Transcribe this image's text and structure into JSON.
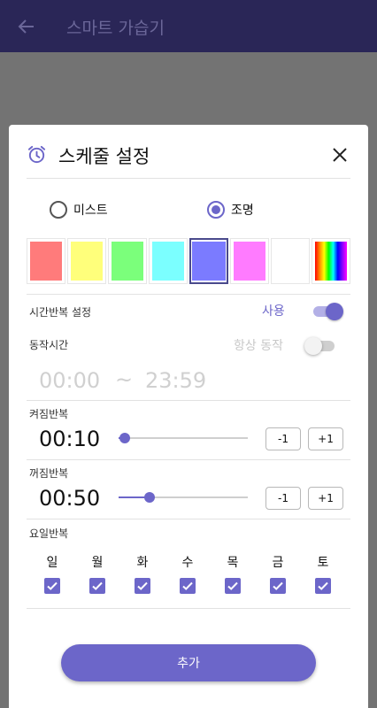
{
  "appbar": {
    "title": "스마트 가습기",
    "back_icon": "arrow-left-icon"
  },
  "dialog": {
    "title": "스케줄 설정",
    "icon": "alarm-clock-icon",
    "close_icon": "close-icon",
    "mode": {
      "options": [
        {
          "label": "미스트",
          "selected": false
        },
        {
          "label": "조명",
          "selected": true
        }
      ]
    },
    "swatches": [
      {
        "color": "#ff7b7b",
        "selected": false
      },
      {
        "color": "#ffff7b",
        "selected": false
      },
      {
        "color": "#7bff7b",
        "selected": false
      },
      {
        "color": "#7bffff",
        "selected": false
      },
      {
        "color": "#7b7bff",
        "selected": true
      },
      {
        "color": "#ff7bff",
        "selected": false
      },
      {
        "color": "#ffffff",
        "selected": false
      },
      {
        "color": "rainbow",
        "selected": false
      }
    ],
    "repeat": {
      "label": "시간반복 설정",
      "status": "사용",
      "enabled": true
    },
    "operation": {
      "label": "동작시간",
      "always_label": "항상 동작",
      "always_enabled": false,
      "start": "00:00",
      "separator": "~",
      "end": "23:59"
    },
    "on_repeat": {
      "label": "켜짐반복",
      "value": "00:10",
      "slider_fraction": 0.05,
      "minus": "-1",
      "plus": "+1"
    },
    "off_repeat": {
      "label": "꺼짐반복",
      "value": "00:50",
      "slider_fraction": 0.24,
      "minus": "-1",
      "plus": "+1"
    },
    "weekday": {
      "label": "요일반복",
      "days": [
        {
          "label": "일",
          "checked": true
        },
        {
          "label": "월",
          "checked": true
        },
        {
          "label": "화",
          "checked": true
        },
        {
          "label": "수",
          "checked": true
        },
        {
          "label": "목",
          "checked": true
        },
        {
          "label": "금",
          "checked": true
        },
        {
          "label": "토",
          "checked": true
        }
      ]
    },
    "add_label": "추가"
  },
  "colors": {
    "accent": "#6c66c9",
    "appbar": "#2a2657"
  }
}
